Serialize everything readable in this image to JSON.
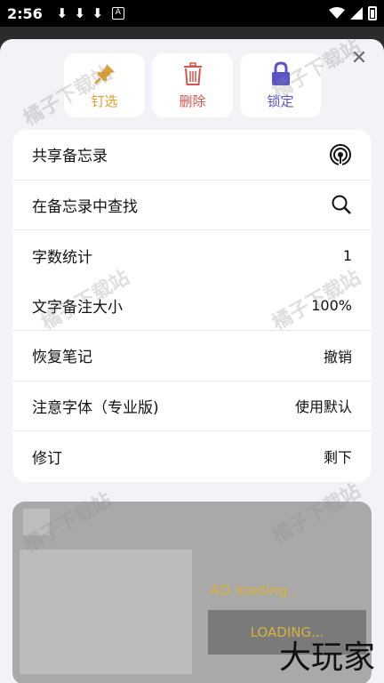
{
  "status_bar": {
    "time": "2:56",
    "download_icons": [
      "download-icon",
      "download-icon",
      "download-icon"
    ]
  },
  "actions": [
    {
      "label": "钉选",
      "icon": "pin-icon",
      "color": "#e0a030"
    },
    {
      "label": "删除",
      "icon": "trash-icon",
      "color": "#d9534f"
    },
    {
      "label": "锁定",
      "icon": "lock-icon",
      "color": "#5a52c8"
    }
  ],
  "menu": {
    "share": {
      "label": "共享备忘录",
      "icon": "share-broadcast-icon"
    },
    "find": {
      "label": "在备忘录中查找",
      "icon": "search-icon"
    },
    "word_count": {
      "label": "字数统计",
      "value": "1"
    },
    "text_note_size": {
      "label": "文字备注大小",
      "value": "100%"
    },
    "restore": {
      "label": "恢复笔记",
      "value": "撤销"
    },
    "font": {
      "label": "注意字体（专业版)",
      "value": "使用默认"
    },
    "revise": {
      "label": "修订",
      "value": "剩下"
    }
  },
  "ad": {
    "loading_text": "AD loading...",
    "button": "LOADING..."
  },
  "watermark": "橘子下载站",
  "brand": "大玩家"
}
